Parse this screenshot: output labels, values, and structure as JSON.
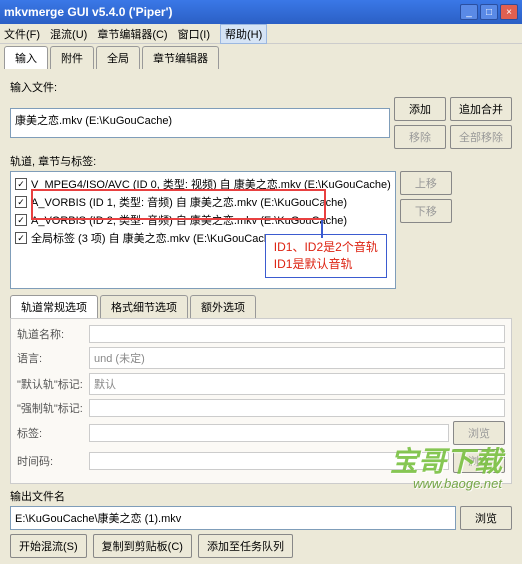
{
  "window": {
    "title": "mkvmerge GUI v5.4.0 ('Piper')"
  },
  "menu": {
    "file": "文件(F)",
    "mux": "混流(U)",
    "chapter_editor": "章节编辑器(C)",
    "window": "窗口(I)",
    "help": "帮助(H)"
  },
  "main_tabs": {
    "input": "输入",
    "attach": "附件",
    "global": "全局",
    "chapter": "章节编辑器"
  },
  "labels": {
    "input_files": "输入文件:",
    "tracks_chapters_tags": "轨道, 章节与标签:",
    "output_filename": "输出文件名"
  },
  "buttons": {
    "add": "添加",
    "append": "追加合并",
    "remove": "移除",
    "remove_all": "全部移除",
    "up": "上移",
    "down": "下移",
    "browse": "浏览",
    "start": "开始混流(S)",
    "copy_cli": "复制到剪贴板(C)",
    "queue": "添加至任务队列"
  },
  "input_file": "康美之恋.mkv (E:\\KuGouCache)",
  "tracks": [
    "V_MPEG4/ISO/AVC (ID 0, 类型: 视频) 自 康美之恋.mkv (E:\\KuGouCache)",
    "A_VORBIS (ID 1, 类型: 音频) 自 康美之恋.mkv (E:\\KuGouCache)",
    "A_VORBIS (ID 2, 类型: 音频) 自 康美之恋.mkv (E:\\KuGouCache)",
    "全局标签 (3 项) 自 康美之恋.mkv (E:\\KuGouCache)"
  ],
  "annotation": {
    "line1": "ID1、ID2是2个音轨",
    "line2": "ID1是默认音轨"
  },
  "track_tabs": {
    "general": "轨道常规选项",
    "detail": "格式细节选项",
    "extra": "额外选项"
  },
  "form": {
    "track_name": {
      "label": "轨道名称:",
      "value": ""
    },
    "language": {
      "label": "语言:",
      "value": "und (未定)"
    },
    "default_flag": {
      "label": "\"默认轨\"标记:",
      "value": "默认"
    },
    "forced_flag": {
      "label": "\"强制轨\"标记:",
      "value": ""
    },
    "tags": {
      "label": "标签:",
      "value": ""
    },
    "timecodes": {
      "label": "时间码:",
      "value": ""
    }
  },
  "output_file": "E:\\KuGouCache\\康美之恋 (1).mkv",
  "watermark": {
    "text": "宝哥下载",
    "url": "www.baoge.net"
  }
}
